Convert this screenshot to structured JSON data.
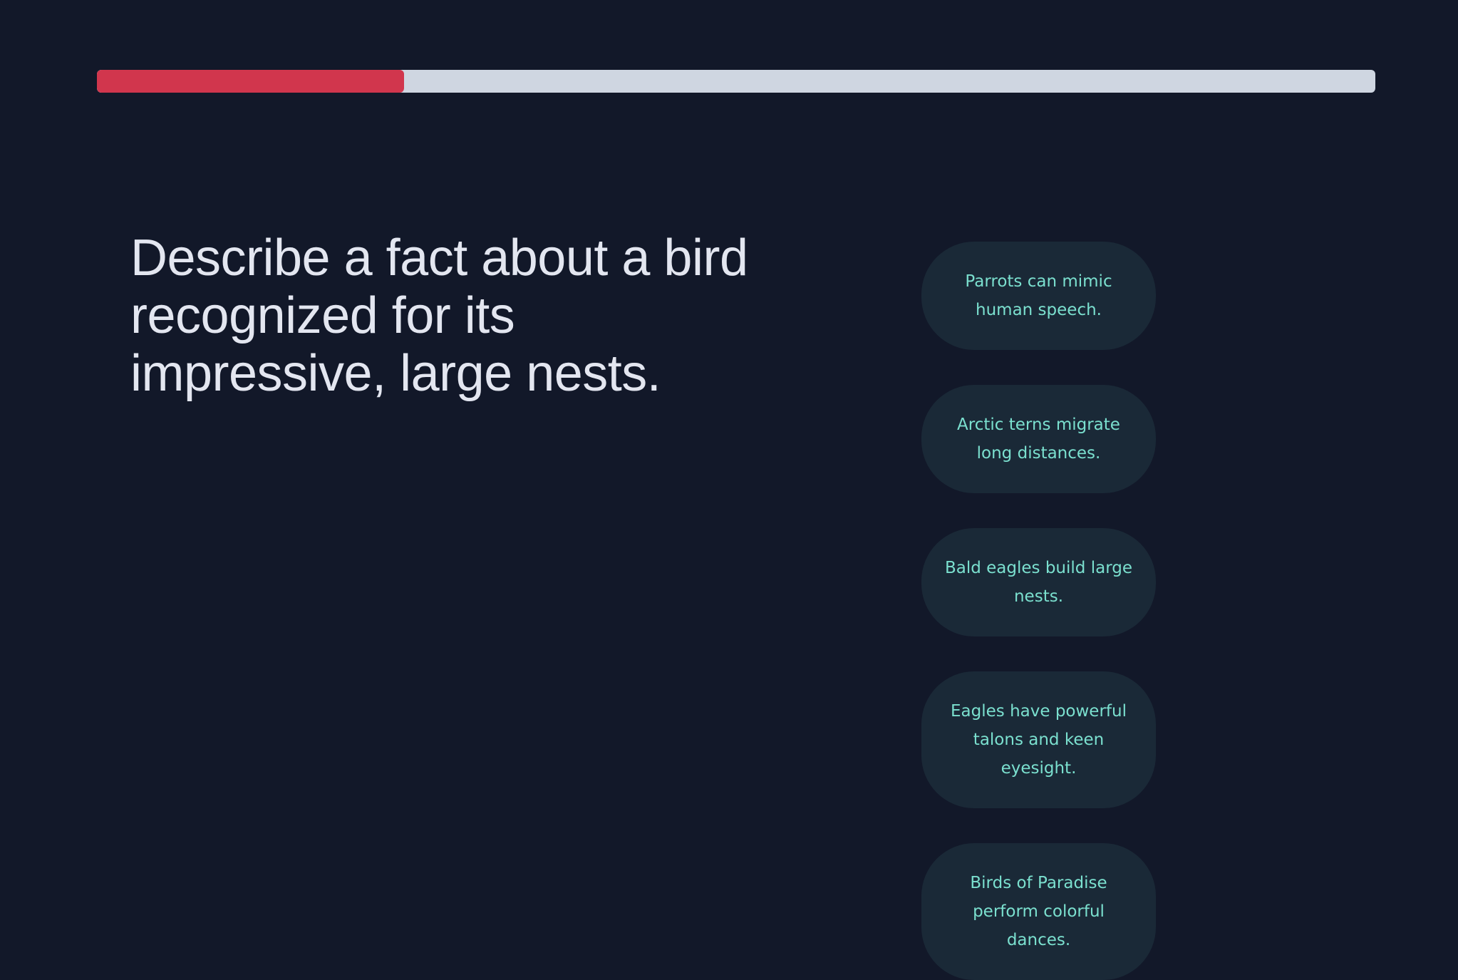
{
  "progress": {
    "value": 0.24,
    "fill_color": "#d1364d",
    "track_color": "#cfd6e1"
  },
  "question": {
    "text": "Describe a fact about a bird recognized for its impressive, large nests."
  },
  "options": [
    {
      "label": "Parrots can mimic human speech."
    },
    {
      "label": "Arctic terns migrate long distances."
    },
    {
      "label": "Bald eagles build large nests."
    },
    {
      "label": "Eagles have powerful talons and keen eyesight."
    },
    {
      "label": "Birds of Paradise perform colorful dances."
    }
  ]
}
